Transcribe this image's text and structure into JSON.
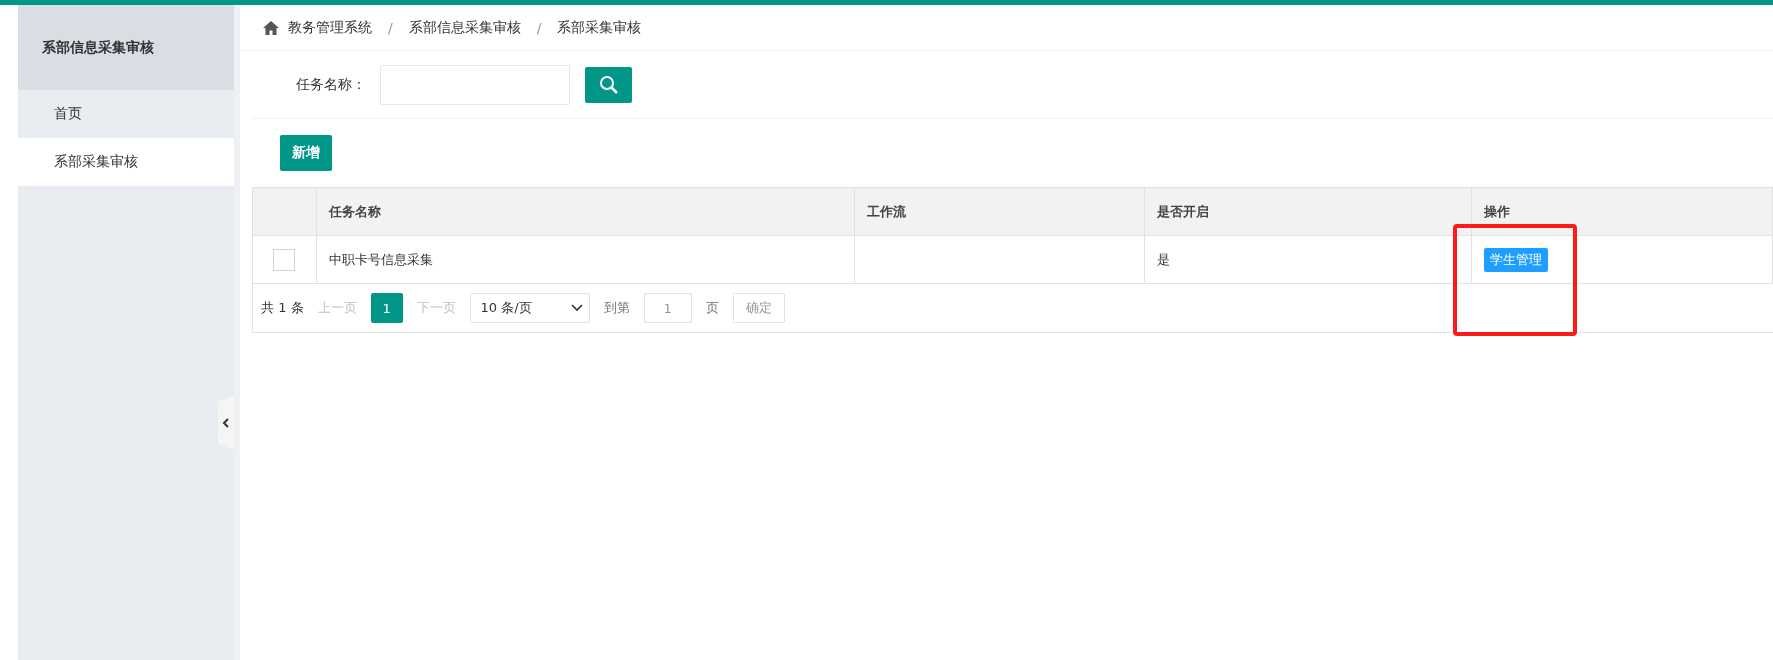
{
  "sidebar": {
    "title": "系部信息采集审核",
    "items": [
      {
        "label": "首页",
        "selected": false
      },
      {
        "label": "系部采集审核",
        "selected": true
      }
    ]
  },
  "breadcrumb": [
    "教务管理系统",
    "系部信息采集审核",
    "系部采集审核"
  ],
  "breadcrumb_separator": "/",
  "search": {
    "label": "任务名称："
  },
  "add_button": "新增",
  "table": {
    "columns": [
      "任务名称",
      "工作流",
      "是否开启",
      "操作"
    ],
    "rows": [
      {
        "checked": false,
        "cells": [
          "中职卡号信息采集",
          "",
          "是"
        ],
        "action": "学生管理"
      }
    ]
  },
  "pager": {
    "total": "共 1 条",
    "prev": "上一页",
    "pages": [
      {
        "label": "1",
        "selected": true
      }
    ],
    "next": "下一页",
    "page_size": "10 条/页",
    "goto": "到第",
    "goto_value": "1",
    "page_unit": "页",
    "confirm": "确定"
  }
}
